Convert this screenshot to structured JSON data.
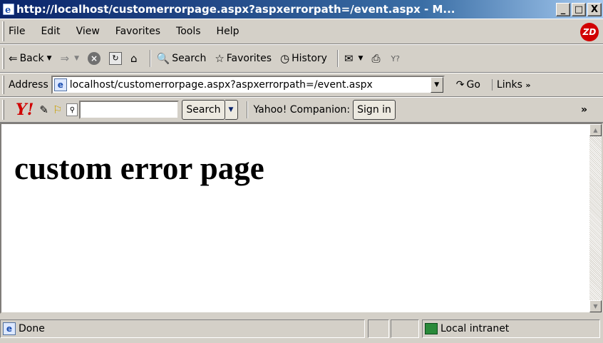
{
  "window": {
    "title": "http://localhost/customerrorpage.aspx?aspxerrorpath=/event.aspx - M...",
    "buttons": {
      "minimize": "_",
      "maximize": "□",
      "close": "X"
    }
  },
  "menu": {
    "items": [
      {
        "label": "File"
      },
      {
        "label": "Edit"
      },
      {
        "label": "View"
      },
      {
        "label": "Favorites"
      },
      {
        "label": "Tools"
      },
      {
        "label": "Help"
      }
    ],
    "logo": "ZD"
  },
  "toolbar": {
    "back": "Back",
    "search": "Search",
    "favorites": "Favorites",
    "history": "History"
  },
  "address": {
    "label": "Address",
    "value": "localhost/customerrorpage.aspx?aspxerrorpath=/event.aspx",
    "go": "Go",
    "links": "Links"
  },
  "yahoo": {
    "logo": "Y!",
    "search_button": "Search",
    "companion_label": "Yahoo! Companion:",
    "signin_button": "Sign in",
    "more": "»"
  },
  "page": {
    "heading": "custom error page"
  },
  "status": {
    "text": "Done",
    "zone": "Local intranet"
  }
}
